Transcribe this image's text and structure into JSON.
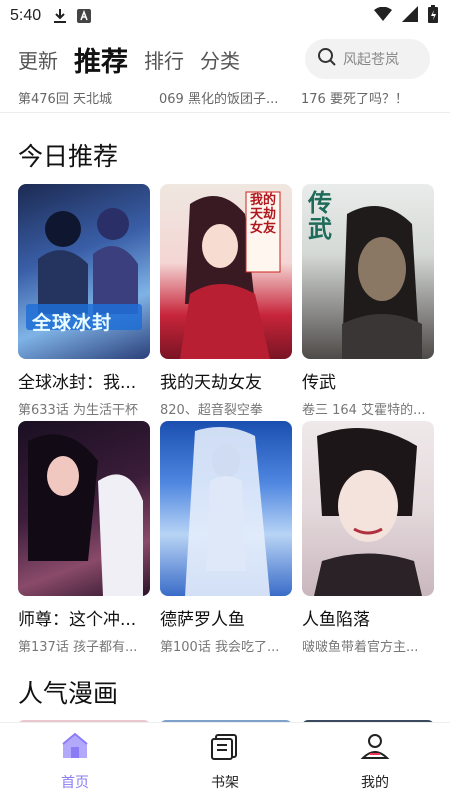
{
  "status_bar": {
    "time": "5:40"
  },
  "header": {
    "tabs": [
      {
        "label": "更新",
        "active": false
      },
      {
        "label": "推荐",
        "active": true
      },
      {
        "label": "排行",
        "active": false
      },
      {
        "label": "分类",
        "active": false
      }
    ],
    "search_placeholder": "风起苍岚"
  },
  "prev_row": [
    "第476回 天北城",
    "069 黑化的饭团子...",
    "176 要死了吗？！"
  ],
  "sections": {
    "today": {
      "title": "今日推荐",
      "items": [
        {
          "title": "全球冰封：我...",
          "sub": "第633话 为生活干杯",
          "cover_text": "全球冰封"
        },
        {
          "title": "我的天劫女友",
          "sub": "820、超音裂空拳",
          "cover_text": "我的天劫女友"
        },
        {
          "title": "传武",
          "sub": "卷三 164 艾霍特的...",
          "cover_text": "传武"
        },
        {
          "title": "师尊：这个冲...",
          "sub": "第137话 孩子都有...",
          "cover_text": ""
        },
        {
          "title": "德萨罗人鱼",
          "sub": "第100话 我会吃了...",
          "cover_text": ""
        },
        {
          "title": "人鱼陷落",
          "sub": "啵啵鱼带着官方主...",
          "cover_text": ""
        }
      ]
    },
    "popular": {
      "title": "人气漫画"
    }
  },
  "bottom_nav": [
    {
      "label": "首页",
      "icon": "home-icon",
      "active": true
    },
    {
      "label": "书架",
      "icon": "bookshelf-icon",
      "active": false
    },
    {
      "label": "我的",
      "icon": "profile-icon",
      "active": false
    }
  ],
  "colors": {
    "accent": "#8b7cf6"
  }
}
